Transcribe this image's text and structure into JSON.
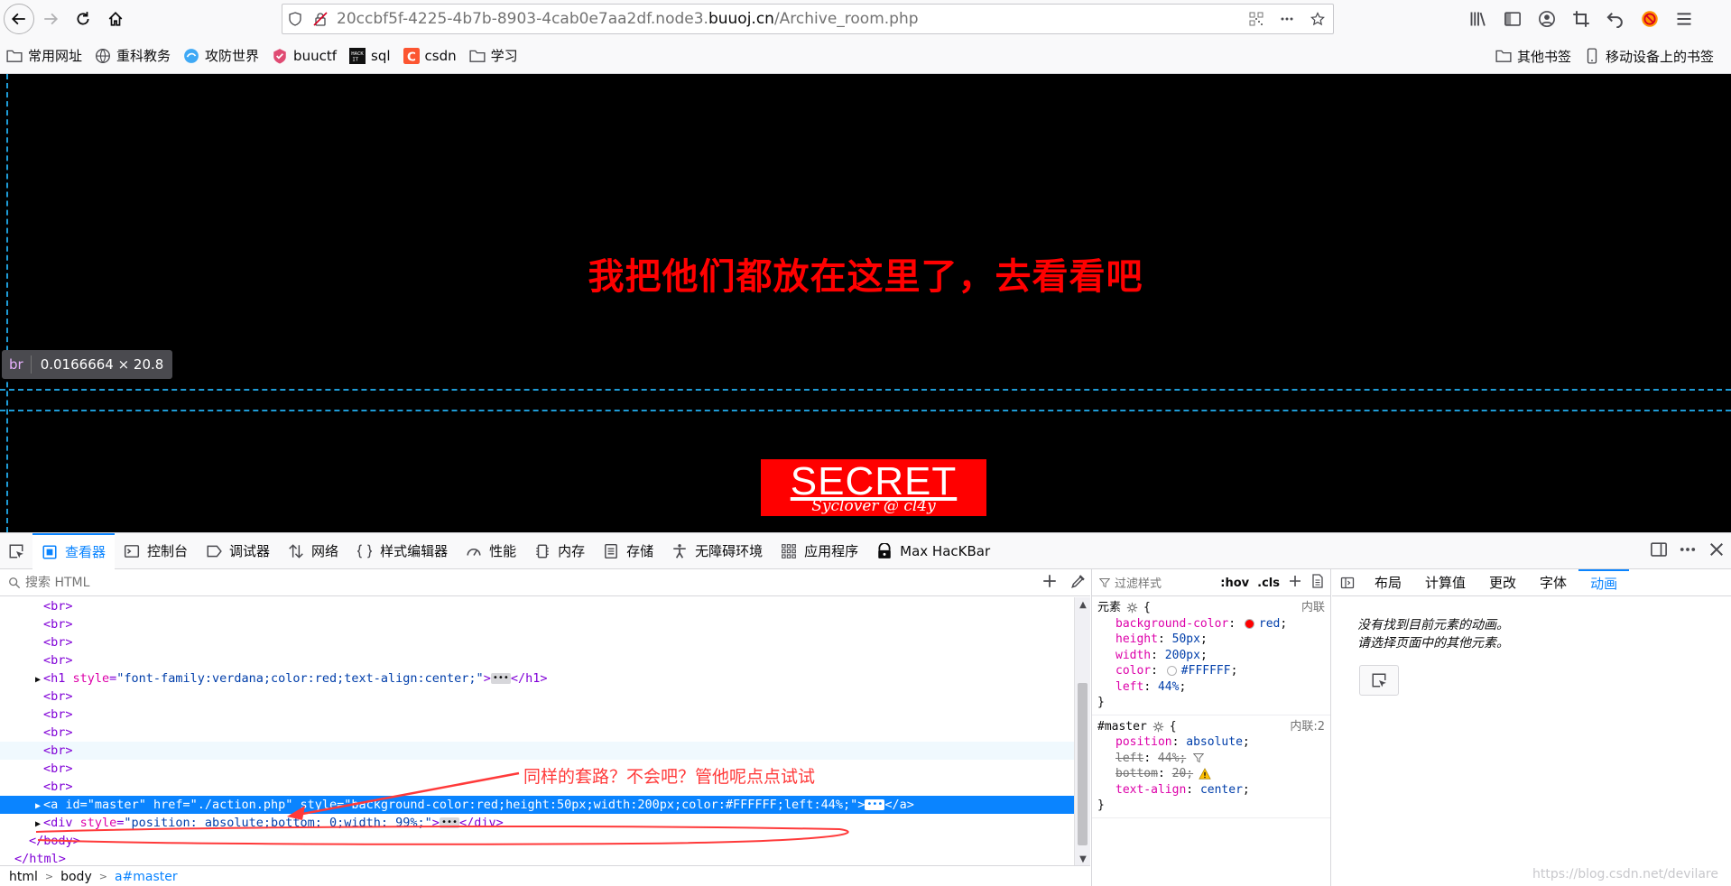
{
  "browser": {
    "url_prefix": "20ccbf5f-4225-4b7b-8903-4cab0e7aa2df.node3.",
    "url_host": "buuoj.cn",
    "url_path": "/Archive_room.php",
    "bookmarks": [
      {
        "label": "常用网址",
        "icon": "folder-icon"
      },
      {
        "label": "重科教务",
        "icon": "globe-icon"
      },
      {
        "label": "攻防世界",
        "icon": "site-icon"
      },
      {
        "label": "buuctf",
        "icon": "site-icon"
      },
      {
        "label": "sql",
        "icon": "hackbar-icon"
      },
      {
        "label": "csdn",
        "icon": "csdn-icon"
      },
      {
        "label": "学习",
        "icon": "folder-icon"
      }
    ],
    "other_bookmarks": "其他书签",
    "mobile_bookmarks": "移动设备上的书签"
  },
  "page": {
    "heading": "我把他们都放在这里了，去看看吧",
    "button_title": "SECRET",
    "button_subtitle": "Syclover @ cl4y",
    "tooltip_tag": "br",
    "tooltip_dims": "0.0166664 × 20.8"
  },
  "devtools": {
    "tabs": [
      {
        "label": "查看器",
        "icon": "inspector-icon"
      },
      {
        "label": "控制台",
        "icon": "console-icon"
      },
      {
        "label": "调试器",
        "icon": "debugger-icon"
      },
      {
        "label": "网络",
        "icon": "network-icon"
      },
      {
        "label": "样式编辑器",
        "icon": "style-editor-icon"
      },
      {
        "label": "性能",
        "icon": "performance-icon"
      },
      {
        "label": "内存",
        "icon": "memory-icon"
      },
      {
        "label": "存储",
        "icon": "storage-icon"
      },
      {
        "label": "无障碍环境",
        "icon": "accessibility-icon"
      },
      {
        "label": "应用程序",
        "icon": "application-icon"
      },
      {
        "label": "Max HacKBar",
        "icon": "hackbar-icon"
      }
    ],
    "search_placeholder": "搜索 HTML",
    "tree": [
      {
        "indent": 3,
        "text": "<br>"
      },
      {
        "indent": 3,
        "text": "<br>"
      },
      {
        "indent": 3,
        "text": "<br>"
      },
      {
        "indent": 3,
        "text": "<br>"
      },
      {
        "indent": 3,
        "expandable": true,
        "tag_open": "<h1 ",
        "attr_name": "style",
        "attr_value": "\"font-family:verdana;color:red;text-align:center;\"",
        "after": ">",
        "has_ellipsis": true,
        "close": "</h1>"
      },
      {
        "indent": 3,
        "text": "<br>"
      },
      {
        "indent": 3,
        "text": "<br>"
      },
      {
        "indent": 3,
        "text": "<br>"
      },
      {
        "indent": 3,
        "text": "<br>",
        "hover": true
      },
      {
        "indent": 3,
        "text": "<br>"
      },
      {
        "indent": 3,
        "text": "<br>"
      },
      {
        "indent": 3,
        "expandable": true,
        "selected": true,
        "tag_open": "<a ",
        "attr_name": "id",
        "attr_value": "\"master\" href=\"./action.php\" style=\"background-color:red;height:50px;width:200px;color:#FFFFFF;left:44%;\"",
        "after": ">",
        "has_ellipsis": true,
        "close": "</a>"
      },
      {
        "indent": 3,
        "expandable": true,
        "tag_open": "<div ",
        "attr_name": "style",
        "attr_value": "\"position: absolute;bottom: 0;width: 99%;\"",
        "after": ">",
        "has_ellipsis": true,
        "close": "</div>"
      },
      {
        "indent": 2,
        "text": "</body>"
      },
      {
        "indent": 1,
        "text": "</html>"
      }
    ],
    "breadcrumbs": [
      "html",
      "body",
      "a#master"
    ],
    "annotation": "同样的套路？不会吧？管他呢点点试试",
    "rules": {
      "filter_placeholder": "过滤样式",
      "hov": ":hov",
      "cls": ".cls",
      "blocks": [
        {
          "selector": "元素",
          "source": "内联",
          "decls": [
            {
              "name": "background-color",
              "value": "red",
              "swatch": "#ff0000"
            },
            {
              "name": "height",
              "value": "50px"
            },
            {
              "name": "width",
              "value": "200px"
            },
            {
              "name": "color",
              "value": "#FFFFFF",
              "swatch": "#ffffff"
            },
            {
              "name": "left",
              "value": "44%"
            }
          ]
        },
        {
          "selector": "#master",
          "source": "内联:2",
          "decls": [
            {
              "name": "position",
              "value": "absolute"
            },
            {
              "name": "left",
              "value": "44%",
              "struck": true,
              "filter": true
            },
            {
              "name": "bottom",
              "value": "20",
              "struck": true,
              "warn": true
            },
            {
              "name": "text-align",
              "value": "center"
            }
          ]
        }
      ]
    },
    "side_tabs": [
      "布局",
      "计算值",
      "更改",
      "字体",
      "动画"
    ],
    "side_active": "动画",
    "animation_msg_1": "没有找到目前元素的动画。",
    "animation_msg_2": "请选择页面中的其他元素。",
    "watermark": "https://blog.csdn.net/devilare"
  },
  "colors": {
    "accent": "#0a84ff",
    "page_bg": "#000000",
    "heading": "#ff0000",
    "annotation": "#ff3a3a"
  }
}
